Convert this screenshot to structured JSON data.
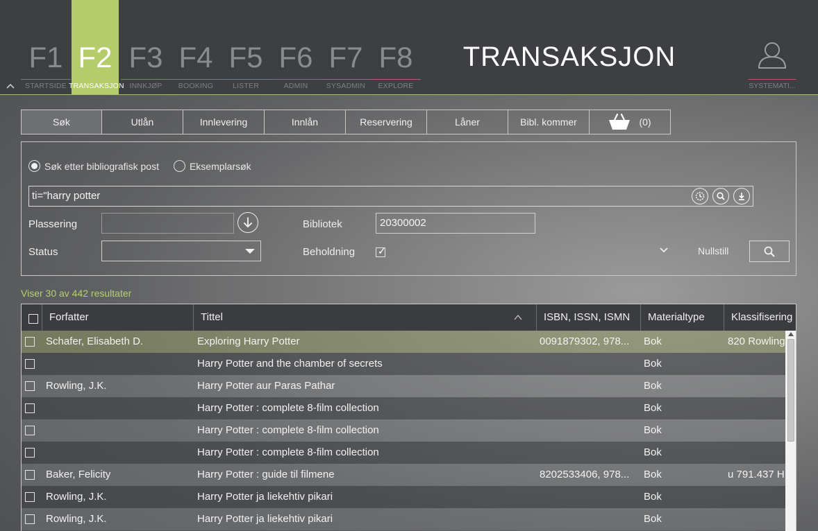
{
  "fkeys": [
    {
      "key": "F1",
      "label": "STARTSIDE",
      "underline": "#7a7d82"
    },
    {
      "key": "F2",
      "label": "TRANSAKSJON",
      "underline": "#b5cc6a"
    },
    {
      "key": "F3",
      "label": "INNKJØP",
      "underline": "#6e8b6e"
    },
    {
      "key": "F4",
      "label": "BOOKING",
      "underline": "#6f7d86"
    },
    {
      "key": "F5",
      "label": "LISTER",
      "underline": "#6a7ea0"
    },
    {
      "key": "F6",
      "label": "ADMIN",
      "underline": "#7a6a9a"
    },
    {
      "key": "F7",
      "label": "SYSADMIN",
      "underline": "#8a6f95"
    },
    {
      "key": "F8",
      "label": "EXPLORE",
      "underline": "#b06070"
    }
  ],
  "active_fkey": "F2",
  "page_title": "TRANSAKSJON",
  "user_label": "SYSTEMATI...",
  "tabs": [
    {
      "label": "Søk"
    },
    {
      "label": "Utlån"
    },
    {
      "label": "Innlevering"
    },
    {
      "label": "Innlån"
    },
    {
      "label": "Reservering"
    },
    {
      "label": "Låner"
    },
    {
      "label": "Bibl. kommer"
    }
  ],
  "basket_count": "(0)",
  "search": {
    "radio_biblio": "Søk etter bibliografisk post",
    "radio_copy": "Eksemplarsøk",
    "query": "ti=\"harry potter",
    "plassering_label": "Plassering",
    "plassering_value": "",
    "bibliotek_label": "Bibliotek",
    "bibliotek_value": "20300002",
    "status_label": "Status",
    "status_value": "",
    "beholdning_label": "Beholdning",
    "beholdning_checked": true,
    "reset_label": "Nullstill"
  },
  "result_count": "Viser 30 av 442 resultater",
  "table": {
    "headers": [
      "Forfatter",
      "Tittel",
      "ISBN, ISSN, ISMN",
      "Materialtype",
      "Klassifisering"
    ],
    "rows": [
      {
        "author": "Schafer, Elisabeth D.",
        "title": "Exploring Harry Potter",
        "isbn": "0091879302, 978...",
        "type": "Bok",
        "class": "820 Rowling"
      },
      {
        "author": "",
        "title": "Harry Potter and the chamber of secrets",
        "isbn": "",
        "type": "Bok",
        "class": ""
      },
      {
        "author": "Rowling, J.K.",
        "title": "Harry Potter aur Paras Pathar",
        "isbn": "",
        "type": "Bok",
        "class": ""
      },
      {
        "author": "",
        "title": "Harry Potter : complete 8-film collection",
        "isbn": "",
        "type": "Bok",
        "class": ""
      },
      {
        "author": "",
        "title": "Harry Potter : complete 8-film collection",
        "isbn": "",
        "type": "Bok",
        "class": ""
      },
      {
        "author": "",
        "title": "Harry Potter : complete 8-film collection",
        "isbn": "",
        "type": "Bok",
        "class": ""
      },
      {
        "author": "Baker, Felicity",
        "title": "Harry Potter : guide til filmene",
        "isbn": "8202533406, 978...",
        "type": "Bok",
        "class": "u 791.437 H"
      },
      {
        "author": "Rowling, J.K.",
        "title": "Harry Potter ja liekehtiv pikari",
        "isbn": "",
        "type": "Bok",
        "class": ""
      },
      {
        "author": "Rowling, J.K.",
        "title": "Harry Potter ja liekehtiv pikari",
        "isbn": "",
        "type": "Bok",
        "class": ""
      }
    ]
  },
  "colors": {
    "accent": "#b5cc6a",
    "topbar": "#3d3f43",
    "result_count": "#b8d06c"
  }
}
